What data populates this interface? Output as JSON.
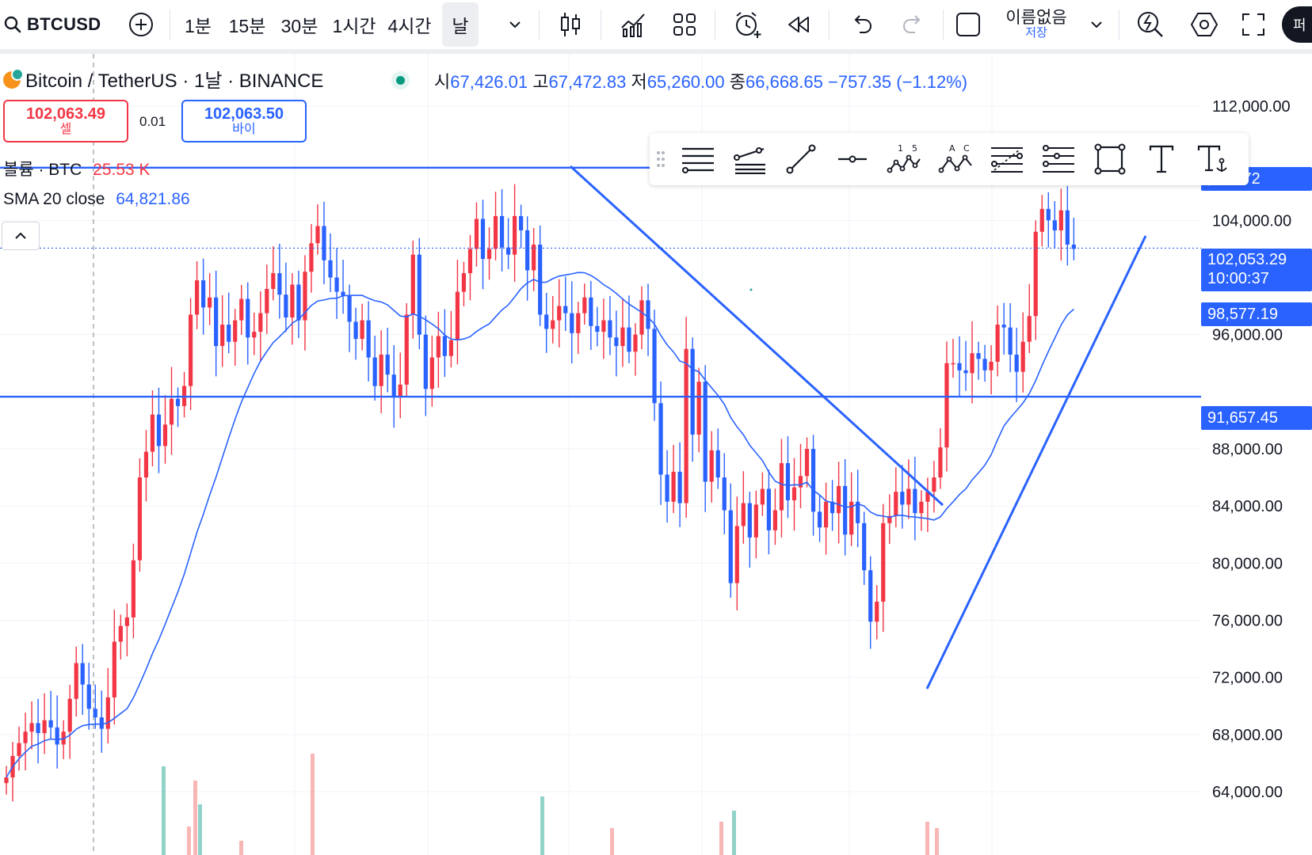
{
  "toolbar": {
    "symbol": "BTCUSD",
    "timeframes": [
      "1분",
      "15분",
      "30분",
      "1시간",
      "4시간",
      "날"
    ],
    "active_timeframe": "날",
    "layout_name": "이름없음",
    "layout_status": "저장",
    "publish": "퍼"
  },
  "legend": {
    "title": "Bitcoin / TetherUS · 1날 · BINANCE",
    "ohlc": [
      {
        "k": "시",
        "v": "67,426.01"
      },
      {
        "k": "고",
        "v": "67,472.83"
      },
      {
        "k": "저",
        "v": "65,260.00"
      },
      {
        "k": "종",
        "v": "66,668.65"
      }
    ],
    "change": "−757.35 (−1.12%)",
    "volume_label": "볼륨 · BTC",
    "volume_value": "25.53 K",
    "sma_label": "SMA 20 close",
    "sma_value": "64,821.86"
  },
  "trade": {
    "sell_price": "102,063.49",
    "sell_label": "셀",
    "spread": "0.01",
    "buy_price": "102,063.50",
    "buy_label": "바이"
  },
  "price_labels": {
    "resistance": "107,685.72",
    "resistance_visible": ",685.72",
    "current": "102,053.29",
    "countdown": "10:00:37",
    "sma": "98,577.19",
    "support": "91,657.45"
  },
  "colors": {
    "up": "#f23645",
    "down": "#2962ff",
    "accent": "#2962ff",
    "vol_up": "#f7a9a8",
    "vol_down": "#7ecbc0"
  },
  "chart_data": {
    "type": "candlestick",
    "symbol": "BTCUSD",
    "interval": "1D",
    "y_ticks": [
      112000,
      104000,
      96000,
      88000,
      84000,
      80000,
      76000,
      72000,
      68000,
      64000
    ],
    "y_tick_labels": [
      "112,000.00",
      "104,000.00",
      "96,000.00",
      "88,000.00",
      "84,000.00",
      "80,000.00",
      "76,000.00",
      "72,000.00",
      "68,000.00",
      "64,000.00"
    ],
    "ylim": [
      63000,
      117000
    ],
    "horizontal_lines": [
      107685.72,
      91657.45
    ],
    "closes": [
      65000,
      66500,
      67400,
      68200,
      68800,
      68100,
      69000,
      68500,
      67300,
      68200,
      70500,
      73000,
      71500,
      69800,
      69200,
      68400,
      70600,
      74500,
      75600,
      76200,
      80200,
      86000,
      87800,
      90400,
      88200,
      89700,
      91500,
      91000,
      92400,
      97400,
      99800,
      97900,
      98600,
      95200,
      96700,
      95500,
      97000,
      98500,
      95800,
      96200,
      97500,
      99200,
      100300,
      98800,
      97200,
      99500,
      97000,
      100400,
      102400,
      103600,
      101200,
      100000,
      99000,
      98700,
      96900,
      95700,
      97000,
      94400,
      92400,
      94600,
      93200,
      91600,
      92500,
      97400,
      101600,
      96000,
      92200,
      94400,
      95900,
      94500,
      95600,
      99000,
      100300,
      102000,
      104100,
      101300,
      102000,
      104300,
      102100,
      101600,
      104300,
      103300,
      100500,
      102300,
      97400,
      96400,
      97000,
      98000,
      97500,
      96100,
      97500,
      98600,
      96600,
      96200,
      97000,
      95800,
      95200,
      96500,
      94800,
      96000,
      98400,
      96400,
      91200,
      86200,
      84300,
      86400,
      84200,
      95000,
      89000,
      92700,
      85700,
      87900,
      86000,
      83700,
      78600,
      82600,
      84200,
      81800,
      84100,
      85200,
      82300,
      83700,
      87000,
      84400,
      85300,
      86100,
      88000,
      83600,
      82500,
      84300,
      83500,
      85400,
      82000,
      84300,
      82800,
      79500,
      75900,
      77300,
      82800,
      83300,
      85000,
      84100,
      85200,
      83500,
      84300,
      85000,
      86000,
      88100,
      94000,
      94000,
      93500,
      93300,
      94700,
      94300,
      93500,
      94100,
      96700,
      96500,
      94600,
      93400,
      95500,
      97300,
      103200,
      104800,
      104000,
      103300,
      104700,
      102300,
      102000
    ]
  },
  "drawing_tools": [
    "horizontal-lines-icon",
    "parallel-channel-icon",
    "trend-line-icon",
    "horizontal-ray-icon",
    "xabcd-pattern-icon",
    "abc-pattern-icon",
    "fib-retracement-icon",
    "fib-extension-icon",
    "rectangle-icon",
    "text-icon",
    "anchored-text-icon"
  ]
}
